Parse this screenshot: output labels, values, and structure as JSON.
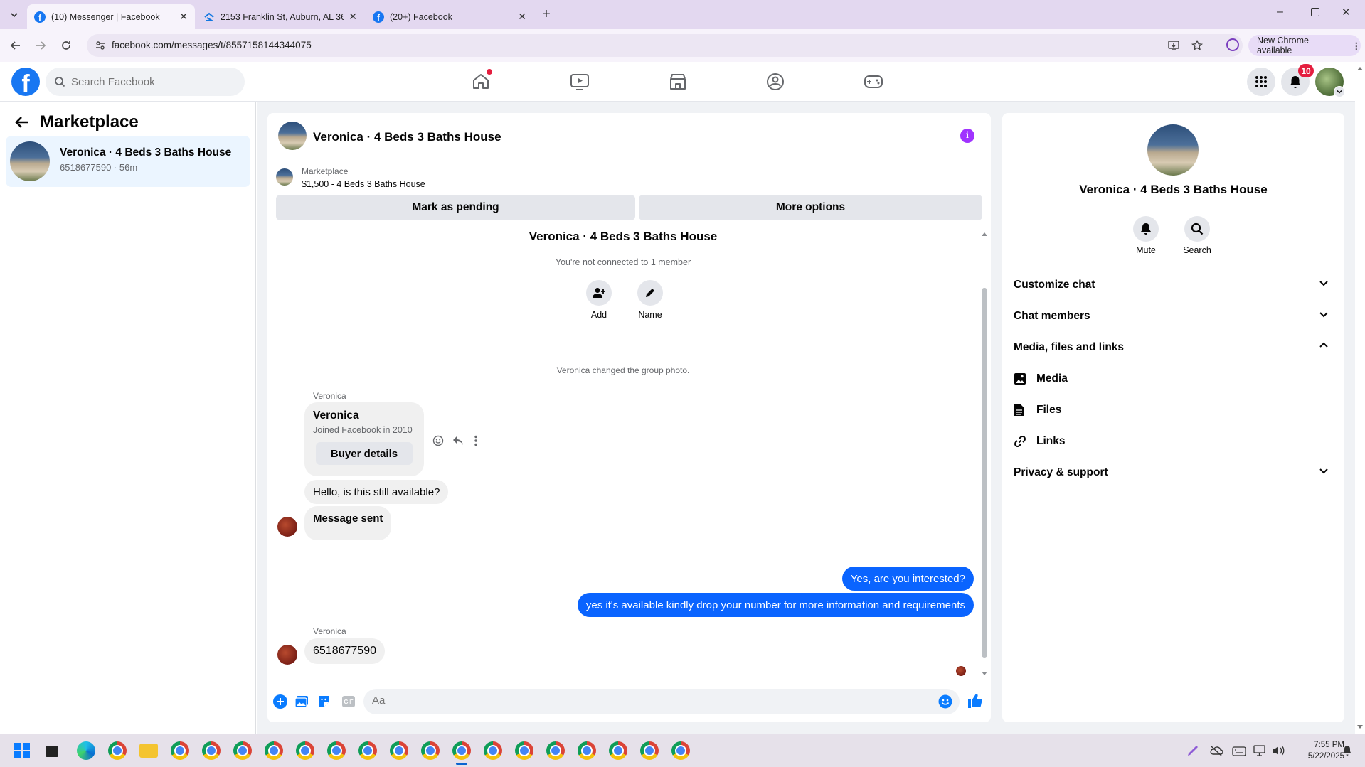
{
  "browser": {
    "tabs": [
      {
        "title": "(10) Messenger | Facebook",
        "active": true
      },
      {
        "title": "2153 Franklin St, Auburn, AL 36…",
        "active": false
      },
      {
        "title": "(20+) Facebook",
        "active": false
      }
    ],
    "url": "facebook.com/messages/t/8557158144344075",
    "new_chrome": "New Chrome available"
  },
  "header": {
    "search_placeholder": "Search Facebook",
    "notifications_count": "10"
  },
  "sidebar": {
    "title": "Marketplace",
    "conversation": {
      "title": "Veronica · 4 Beds 3 Baths House",
      "subtitle": "6518677590 · 56m"
    }
  },
  "chat": {
    "title": "Veronica · 4 Beds 3 Baths House",
    "listing": {
      "label": "Marketplace",
      "detail": "$1,500 - 4 Beds 3 Baths House"
    },
    "mark_pending": "Mark as pending",
    "more_options": "More options",
    "group_title": "Veronica · 4 Beds 3 Baths House",
    "not_connected": "You're not connected to 1 member",
    "add_label": "Add",
    "name_label": "Name",
    "event_text": "Veronica changed the group photo.",
    "sender_label_1": "Veronica",
    "card": {
      "name": "Veronica",
      "joined": "Joined Facebook in 2010",
      "button": "Buyer details"
    },
    "msg_1": "Hello, is this still available?",
    "msg_2": "Message sent",
    "msg_3": "Yes, are you interested?",
    "msg_4": "yes it's available kindly drop your number for more information and requirements",
    "sender_label_2": "Veronica",
    "msg_5": "6518677590",
    "input_placeholder": "Aa",
    "gif_label": "GIF"
  },
  "info": {
    "title": "Veronica · 4 Beds 3 Baths House",
    "mute": "Mute",
    "search": "Search",
    "sections": [
      "Customize chat",
      "Chat members",
      "Media, files and links"
    ],
    "media": "Media",
    "files": "Files",
    "links": "Links",
    "privacy": "Privacy & support"
  },
  "taskbar": {
    "time": "7:55 PM",
    "date": "5/22/2025"
  },
  "colors": {
    "fb_blue": "#1877f2",
    "bubble_blue": "#0a64ff",
    "purple": "#a033ff"
  }
}
